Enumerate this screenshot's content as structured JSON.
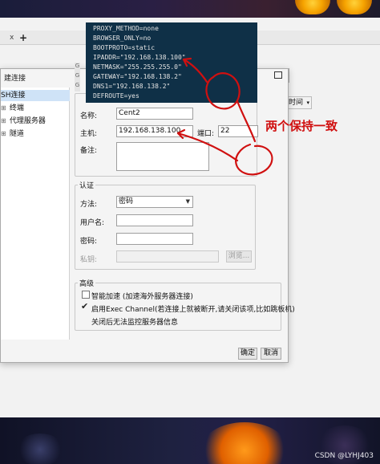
{
  "terminal": {
    "lines": [
      "PROXY_METHOD=none",
      "BROWSER_ONLY=no",
      "BOOTPROTO=static",
      "IPADDR=\"192.168.138.100\"",
      "NETMASK=\"255.255.255.0\"",
      "GATEWAY=\"192.168.138.2\"",
      "DNS1=\"192.168.138.2\"",
      "DEFROUTE=yes"
    ],
    "gutter": [
      "G",
      "G",
      "G"
    ]
  },
  "dialog": {
    "title_fragment": "建连接",
    "tree": [
      {
        "label": "SH连接",
        "toggle": "",
        "selected": true
      },
      {
        "label": "终端",
        "toggle": "⊞",
        "selected": false
      },
      {
        "label": "代理服务器",
        "toggle": "⊞",
        "selected": false
      },
      {
        "label": "隧道",
        "toggle": "⊞",
        "selected": false
      }
    ],
    "name_label": "名称:",
    "name_value": "Cent2",
    "host_label": "主机:",
    "host_value": "192.168.138.100",
    "port_label": "端口:",
    "port_value": "22",
    "note_label": "备注:",
    "auth": {
      "title": "认证",
      "method_label": "方法:",
      "method_value": "密码",
      "user_label": "用户名:",
      "password_label": "密码:",
      "key_label": "私钥:",
      "browse_label": "浏览..."
    },
    "advanced": {
      "title": "高级",
      "option1": "智能加速 (加速海外服务器连接)",
      "option1_checked": false,
      "option2_line1": "启用Exec Channel(若连接上就被断开,请关闭该项,比如跳板机)",
      "option2_line2": "关闭后无法监控服务器信息",
      "option2_checked": true
    },
    "ok_label": "确定",
    "cancel_label": "取消"
  },
  "side": {
    "time_label": "时间"
  },
  "annotation": {
    "text": "两个保持一致",
    "color": "#d01010"
  },
  "background_tab": {
    "close_glyph": "x",
    "add_glyph": "+"
  },
  "watermark": "CSDN @LYHJ403"
}
